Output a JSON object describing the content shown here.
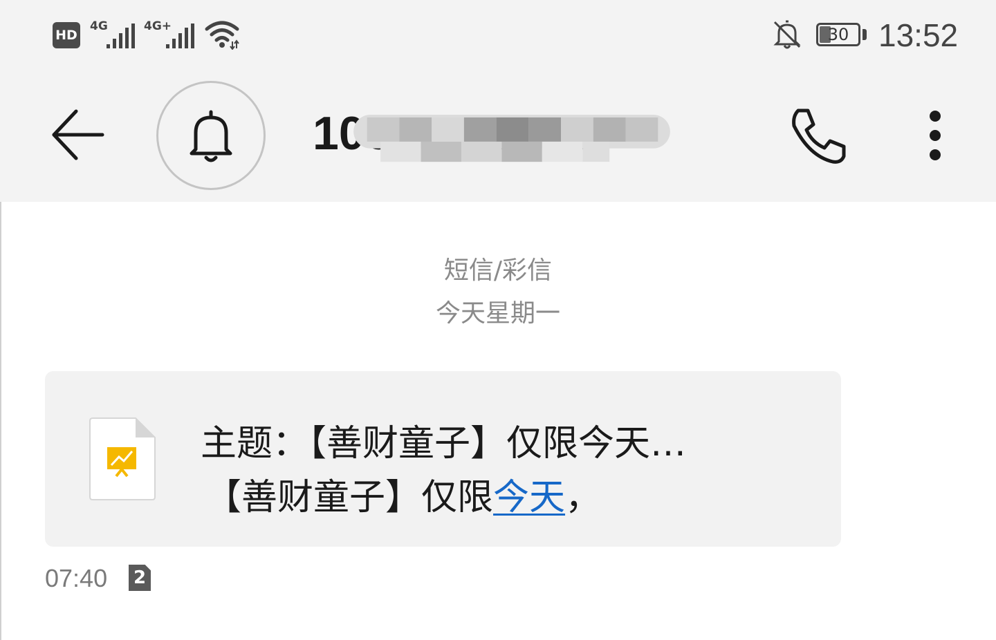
{
  "status_bar": {
    "hd_label": "HD",
    "network1": "4G",
    "network2": "4G+",
    "battery": "30",
    "time": "13:52"
  },
  "header": {
    "title": "1067…065…",
    "icons": [
      "back-arrow-icon",
      "bell-icon",
      "phone-icon",
      "more-icon"
    ]
  },
  "conversation": {
    "type_label": "短信/彩信",
    "date_label": "今天星期一"
  },
  "message": {
    "subject": "主题：【善财童子】仅限今天…",
    "body_prefix": "【善财童子】仅限",
    "body_link": "今天",
    "body_suffix": "，",
    "time": "07:40",
    "sim": "2",
    "attachment_icon": "presentation-file-icon"
  },
  "colors": {
    "header_bg": "#f3f3f3",
    "bubble_bg": "#f2f2f2",
    "link": "#1668c8",
    "attachment_accent": "#f5b800"
  }
}
